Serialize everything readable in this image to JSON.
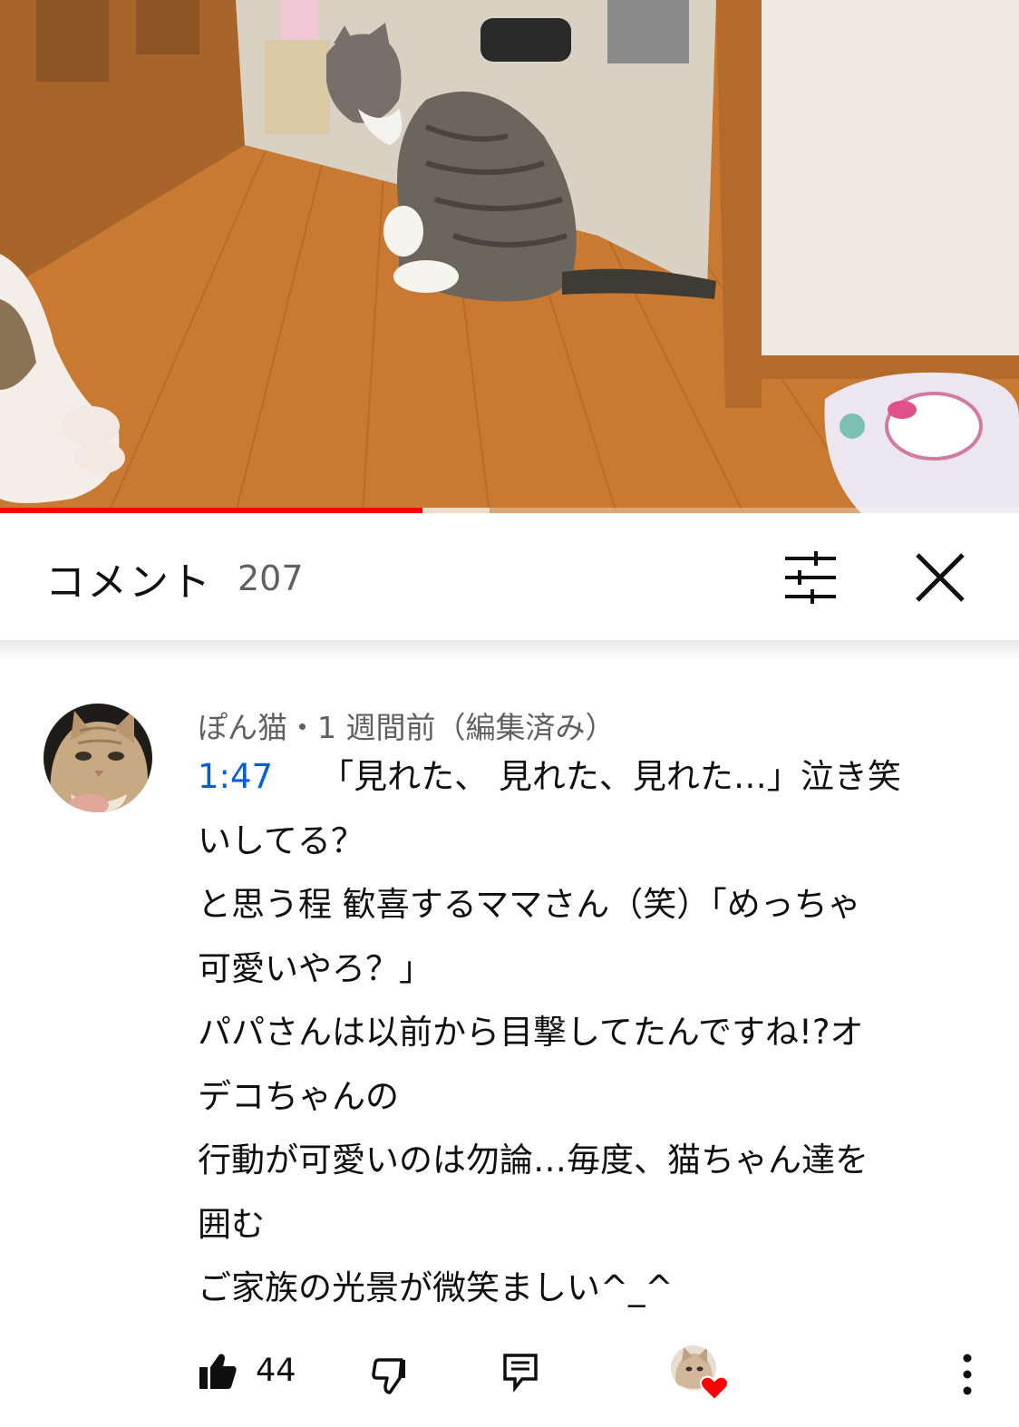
{
  "video": {
    "progress_fraction": 0.415,
    "buffered_fraction": 0.48,
    "accent_color": "#ff0000"
  },
  "comments_header": {
    "title": "コメント",
    "count": "207",
    "filter_icon": "sliders-icon",
    "close_icon": "close-icon"
  },
  "comment": {
    "author": "ぽん猫",
    "separator": "・",
    "time": "1 週間前（編集済み）",
    "timestamp_link": "1:47",
    "lines": [
      "「見れた、 見れた、見れた…」泣き笑",
      "いしてる？",
      "と思う程 歓喜するママさん（笑）「めっちゃ",
      "可愛いやろ？」",
      "パパさんは以前から目撃してたんですね!?オ",
      "デコちゃんの",
      "行動が可愛いのは勿論…毎度、猫ちゃん達を",
      "囲む",
      "ご家族の光景が微笑ましい^_^"
    ],
    "link_color": "#065fd4",
    "likes": "44",
    "icons": {
      "like": "thumbs-up-icon",
      "dislike": "thumbs-down-icon",
      "reply": "reply-icon",
      "creator_heart": "heart-icon",
      "more": "more-vertical-icon"
    },
    "heart_color": "#ff0000"
  }
}
